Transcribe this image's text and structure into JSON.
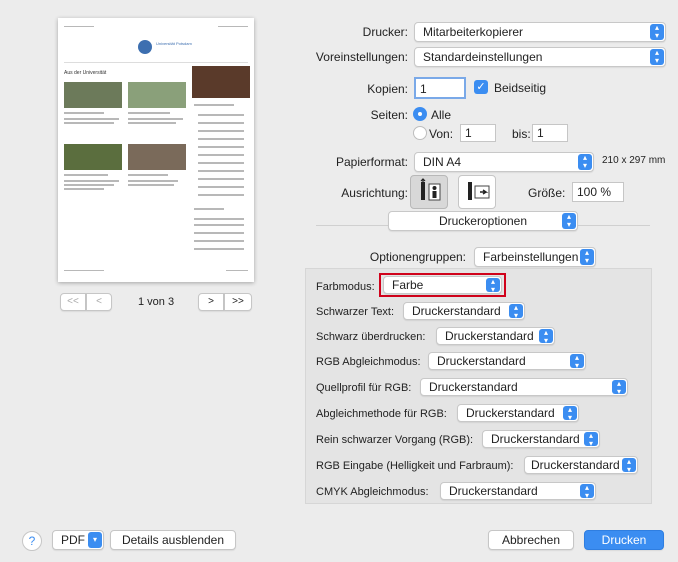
{
  "preview": {
    "site_title": "Universität Potsdam",
    "section_heading": "Aus der Universität",
    "page_indicator": "1 von 3",
    "nav_first": "<<",
    "nav_prev": "<",
    "nav_next": ">",
    "nav_last": ">>"
  },
  "printer": {
    "label": "Drucker:",
    "value": "Mitarbeiterkopierer"
  },
  "presets": {
    "label": "Voreinstellungen:",
    "value": "Standardeinstellungen"
  },
  "copies": {
    "label": "Kopien:",
    "value": "1",
    "duplex_label": "Beidseitig"
  },
  "pages": {
    "label": "Seiten:",
    "all_label": "Alle",
    "from_label": "Von:",
    "from_value": "1",
    "to_label": "bis:",
    "to_value": "1"
  },
  "paper": {
    "label": "Papierformat:",
    "value": "DIN A4",
    "size_text": "210 x 297 mm"
  },
  "orientation": {
    "label": "Ausrichtung:"
  },
  "scale": {
    "label": "Größe:",
    "value": "100 %"
  },
  "section_popup": {
    "value": "Druckeroptionen"
  },
  "option_groups": {
    "label": "Optionengruppen:",
    "value": "Farbeinstellungen"
  },
  "options": [
    {
      "label": "Farbmodus:",
      "value": "Farbe"
    },
    {
      "label": "Schwarzer Text:",
      "value": "Druckerstandard"
    },
    {
      "label": "Schwarz überdrucken:",
      "value": "Druckerstandard"
    },
    {
      "label": "RGB Abgleichmodus:",
      "value": "Druckerstandard"
    },
    {
      "label": "Quellprofil für RGB:",
      "value": "Druckerstandard"
    },
    {
      "label": "Abgleichmethode für RGB:",
      "value": "Druckerstandard"
    },
    {
      "label": "Rein schwarzer Vorgang (RGB):",
      "value": "Druckerstandard"
    },
    {
      "label": "RGB Eingabe (Helligkeit und Farbraum):",
      "value": "Druckerstandard"
    },
    {
      "label": "CMYK Abgleichmodus:",
      "value": "Druckerstandard"
    }
  ],
  "footer": {
    "help": "?",
    "pdf": "PDF",
    "details": "Details ausblenden",
    "cancel": "Abbrechen",
    "print": "Drucken"
  },
  "colors": {
    "accent": "#3b8df1",
    "highlight_border": "#d0021b"
  }
}
